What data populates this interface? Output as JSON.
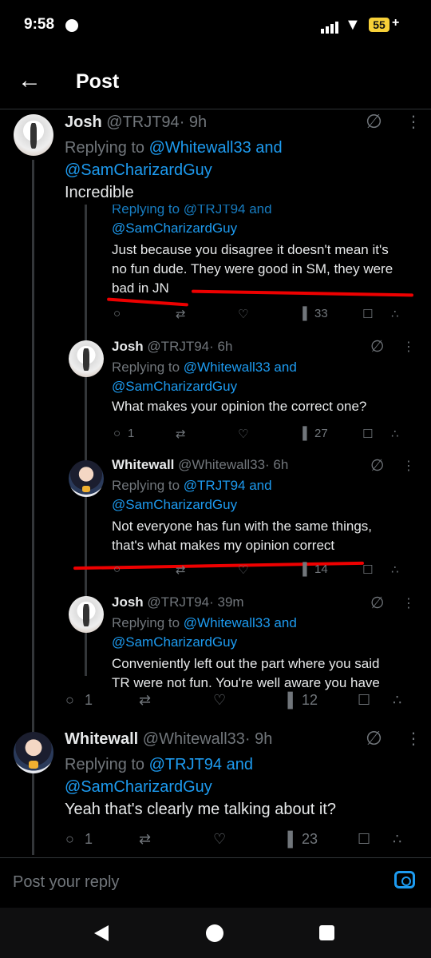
{
  "status": {
    "time": "9:58",
    "battery": "55"
  },
  "header": {
    "title": "Post"
  },
  "main_post": {
    "name": "Josh",
    "handle": "@TRJT94",
    "time": "· 9h",
    "reply_prefix": "Replying to ",
    "reply_to_1": "@Whitewall33 and",
    "reply_to_2": "@SamCharizardGuy",
    "text": "Incredible"
  },
  "quoted": {
    "partial_reply": "Replying to @TRJT94 and",
    "reply_to_2": "@SamCharizardGuy",
    "text_1": "Just because you disagree it doesn't mean it's",
    "text_2": "no fun dude. They were good in SM, they were",
    "text_3": "bad in JN",
    "views": "33",
    "q2": {
      "name": "Josh",
      "handle": "@TRJT94",
      "time": "· 6h",
      "reply_prefix": "Replying to ",
      "reply_to_1": "@Whitewall33 and",
      "reply_to_2": "@SamCharizardGuy",
      "text": "What makes your opinion the correct one?",
      "replies": "1",
      "views": "27"
    },
    "q3": {
      "name": "Whitewall",
      "handle": "@Whitewall33",
      "time": "· 6h",
      "reply_prefix": "Replying to ",
      "reply_to_1": "@TRJT94 and",
      "reply_to_2": "@SamCharizardGuy",
      "text_1": "Not everyone has fun with the same things,",
      "text_2": "that's what makes my opinion correct",
      "views": "14"
    },
    "q4": {
      "name": "Josh",
      "handle": "@TRJT94",
      "time": "· 39m",
      "reply_prefix": "Replying to ",
      "reply_to_1": "@Whitewall33 and",
      "reply_to_2": "@SamCharizardGuy",
      "text_1": "Conveniently left out the part where you said",
      "text_2": "TR were not fun. You're well aware you have"
    }
  },
  "main_actions": {
    "replies": "1",
    "views": "12"
  },
  "reply_post": {
    "name": "Whitewall",
    "handle": "@Whitewall33",
    "time": "· 9h",
    "reply_prefix": "Replying to ",
    "reply_to_1": "@TRJT94 and",
    "reply_to_2": "@SamCharizardGuy",
    "text": "Yeah that's clearly me talking about it?",
    "replies": "1",
    "views": "23"
  },
  "composer": {
    "placeholder": "Post your reply"
  },
  "colors": {
    "link": "#1d9bf0",
    "muted": "#71767b",
    "annotation": "#e00000",
    "battery": "#f7d038"
  }
}
